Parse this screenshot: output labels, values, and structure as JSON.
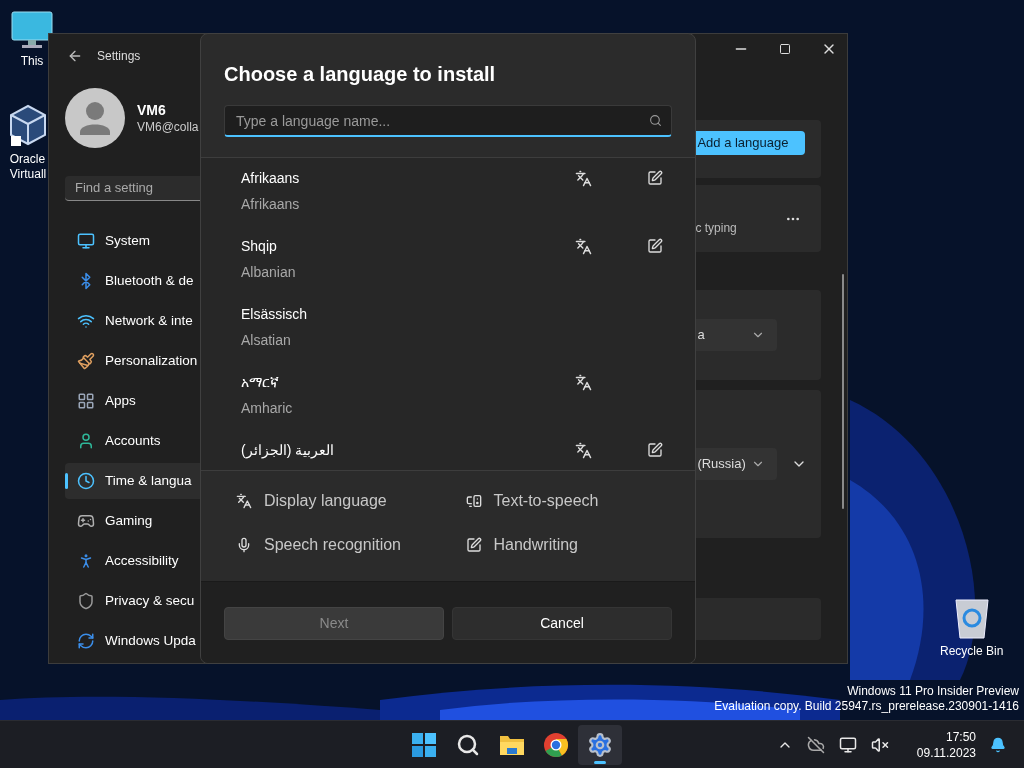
{
  "desktop_icons": [
    {
      "kind": "monitor",
      "lines": [
        "This"
      ]
    },
    {
      "kind": "cube",
      "lines": [
        "Oracle",
        "Virtuall"
      ]
    },
    {
      "kind": "recycle",
      "lines": [
        "Recycle Bin"
      ]
    }
  ],
  "settings_window": {
    "title": "Settings",
    "user": {
      "name": "VM6",
      "email": "VM6@colla"
    },
    "search": {
      "placeholder": "Find a setting"
    },
    "nav": [
      {
        "kind": "system",
        "label": "System",
        "selected": false
      },
      {
        "kind": "bluetooth",
        "label": "Bluetooth & de",
        "selected": false
      },
      {
        "kind": "network",
        "label": "Network & inte",
        "selected": false
      },
      {
        "kind": "personalization",
        "label": "Personalization",
        "selected": false
      },
      {
        "kind": "apps",
        "label": "Apps",
        "selected": false
      },
      {
        "kind": "accounts",
        "label": "Accounts",
        "selected": false
      },
      {
        "kind": "time",
        "label": "Time & langua",
        "selected": true
      },
      {
        "kind": "gaming",
        "label": "Gaming",
        "selected": false
      },
      {
        "kind": "accessibility",
        "label": "Accessibility",
        "selected": false
      },
      {
        "kind": "privacy",
        "label": "Privacy & secu",
        "selected": false
      },
      {
        "kind": "update",
        "label": "Windows Upda",
        "selected": false
      }
    ],
    "add_language_button": "Add a language",
    "card_text": "c typing",
    "dropdowns": [
      {
        "value": "a"
      },
      {
        "value": "(Russia)"
      }
    ]
  },
  "dialog": {
    "title": "Choose a language to install",
    "search": {
      "placeholder": "Type a language name..."
    },
    "languages": [
      {
        "name": "Afrikaans",
        "english": "Afrikaans",
        "display_language": true,
        "handwriting": true
      },
      {
        "name": "Shqip",
        "english": "Albanian",
        "display_language": true,
        "handwriting": true
      },
      {
        "name": "Elsässisch",
        "english": "Alsatian",
        "display_language": false,
        "handwriting": false
      },
      {
        "name": "አማርኛ",
        "english": "Amharic",
        "display_language": true,
        "handwriting": false
      },
      {
        "name": "العربية (الجزائر)",
        "display_language": true,
        "handwriting": true
      }
    ],
    "features": [
      {
        "kind": "display",
        "label": "Display language"
      },
      {
        "kind": "tts",
        "label": "Text-to-speech"
      },
      {
        "kind": "speech",
        "label": "Speech recognition"
      },
      {
        "kind": "handwriting",
        "label": "Handwriting"
      }
    ],
    "buttons": [
      {
        "label": "Next",
        "disabled": true
      },
      {
        "label": "Cancel",
        "disabled": false
      }
    ]
  },
  "build_info": [
    "Windows 11 Pro Insider Preview",
    "Evaluation copy. Build 25947.rs_prerelease.230901-1416"
  ],
  "taskbar": {
    "apps": [
      {
        "kind": "start",
        "selected": false
      },
      {
        "kind": "search",
        "selected": false
      },
      {
        "kind": "folder",
        "selected": false
      },
      {
        "kind": "browser",
        "selected": false
      },
      {
        "kind": "settings",
        "selected": true
      }
    ],
    "time": "17:50",
    "date": "09.11.2023"
  }
}
